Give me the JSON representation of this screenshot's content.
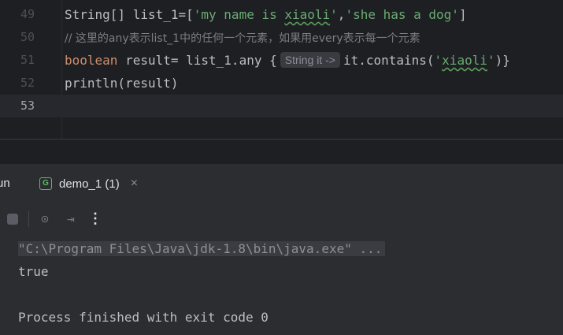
{
  "editor": {
    "lines": [
      {
        "num": "49",
        "parts": [
          {
            "t": "String[] list_1=[",
            "c": "plain"
          },
          {
            "t": "'my name is ",
            "c": "str"
          },
          {
            "t": "xiaoli",
            "c": "str wavy"
          },
          {
            "t": "'",
            "c": "str"
          },
          {
            "t": ",",
            "c": "plain"
          },
          {
            "t": "'she has a dog'",
            "c": "str"
          },
          {
            "t": "]",
            "c": "plain"
          }
        ]
      },
      {
        "num": "50",
        "parts": [
          {
            "t": "// 这里的any表示list_1中的任何一个元素，如果用every表示每一个元素",
            "c": "cm"
          }
        ]
      },
      {
        "num": "51",
        "parts": [
          {
            "t": "boolean",
            "c": "kw"
          },
          {
            "t": " result= list_1.any {",
            "c": "plain"
          },
          {
            "t": "String it ->",
            "c": "hint"
          },
          {
            "t": "it.contains(",
            "c": "plain"
          },
          {
            "t": "'",
            "c": "str"
          },
          {
            "t": "xiaoli",
            "c": "str wavy"
          },
          {
            "t": "'",
            "c": "str"
          },
          {
            "t": ")}",
            "c": "plain"
          }
        ]
      },
      {
        "num": "52",
        "parts": [
          {
            "t": "println(result)",
            "c": "plain"
          }
        ]
      },
      {
        "num": "53",
        "parts": [],
        "current": true
      }
    ]
  },
  "tool_window": {
    "title": "un",
    "tab_icon_letter": "G",
    "tab_label": "demo_1 (1)",
    "tab_close": "×"
  },
  "console_toolbar": {
    "icons": [
      "stop-icon",
      "camera-icon",
      "exit-icon",
      "more-vertical-icon"
    ],
    "camera_glyph": "⊙",
    "exit_glyph": "⇥",
    "more_glyph": "⋮"
  },
  "console": {
    "command": "\"C:\\Program Files\\Java\\jdk-1.8\\bin\\java.exe\" ...",
    "result": "true",
    "blank": "",
    "finished": "Process finished with exit code 0"
  }
}
